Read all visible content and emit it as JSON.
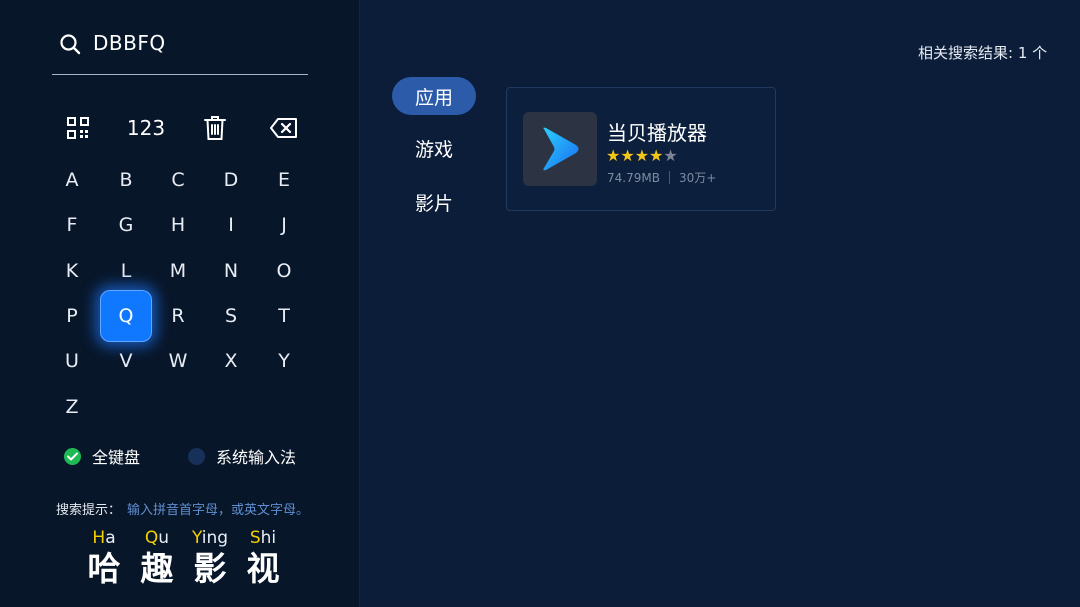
{
  "search": {
    "query": "DBBFQ"
  },
  "toolbar": {
    "num_label": "123"
  },
  "keyboard": {
    "rows": [
      [
        "A",
        "B",
        "C",
        "D",
        "E"
      ],
      [
        "F",
        "G",
        "H",
        "I",
        "J"
      ],
      [
        "K",
        "L",
        "M",
        "N",
        "O"
      ],
      [
        "P",
        "Q",
        "R",
        "S",
        "T"
      ],
      [
        "U",
        "V",
        "W",
        "X",
        "Y"
      ],
      [
        "Z"
      ]
    ],
    "selected": "Q"
  },
  "input_modes": {
    "full_keyboard": {
      "label": "全键盘",
      "selected": true
    },
    "system_ime": {
      "label": "系统输入法",
      "selected": false
    }
  },
  "hint": {
    "label": "搜索提示：",
    "text": "输入拼音首字母，或英文字母。"
  },
  "logo": {
    "syllables": [
      {
        "initial": "H",
        "rest": "a",
        "char": "哈"
      },
      {
        "initial": "Q",
        "rest": "u",
        "char": "趣"
      },
      {
        "initial": "Y",
        "rest": "ing",
        "char": "影"
      },
      {
        "initial": "S",
        "rest": "hi",
        "char": "视"
      }
    ]
  },
  "results": {
    "count_label": "相关搜索结果: 1 个"
  },
  "categories": [
    {
      "label": "应用",
      "active": true
    },
    {
      "label": "游戏",
      "active": false
    },
    {
      "label": "影片",
      "active": false
    }
  ],
  "app_card": {
    "name": "当贝播放器",
    "rating": 4,
    "rating_max": 5,
    "size": "74.79MB",
    "downloads": "30万+"
  },
  "colors": {
    "accent": "#0f78ff",
    "star_filled": "#f5c518",
    "star_empty": "#7b8594",
    "pinyin_initial": "#f4d000",
    "check_green": "#1db954"
  }
}
